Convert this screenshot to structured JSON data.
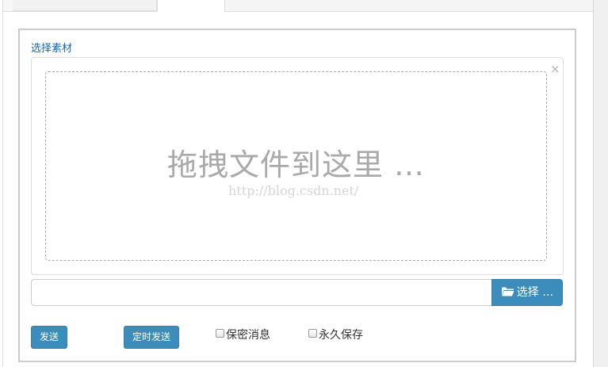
{
  "uploader": {
    "section_label": "选择素材",
    "close_glyph": "×",
    "drop_text": "拖拽文件到这里 …",
    "watermark": "http://blog.csdn.net/",
    "browse_label": "选择 …"
  },
  "actions": {
    "send_label": "发送",
    "schedule_label": "定时发送"
  },
  "options": [
    {
      "label": "保密消息",
      "checked": false
    },
    {
      "label": "永久保存",
      "checked": false
    }
  ],
  "colors": {
    "primary": "#3c8dbc",
    "link": "#1a64b4",
    "drop_text": "#a9a9a9"
  },
  "icons": {
    "browse": "folder-open-icon",
    "close": "close-icon"
  }
}
